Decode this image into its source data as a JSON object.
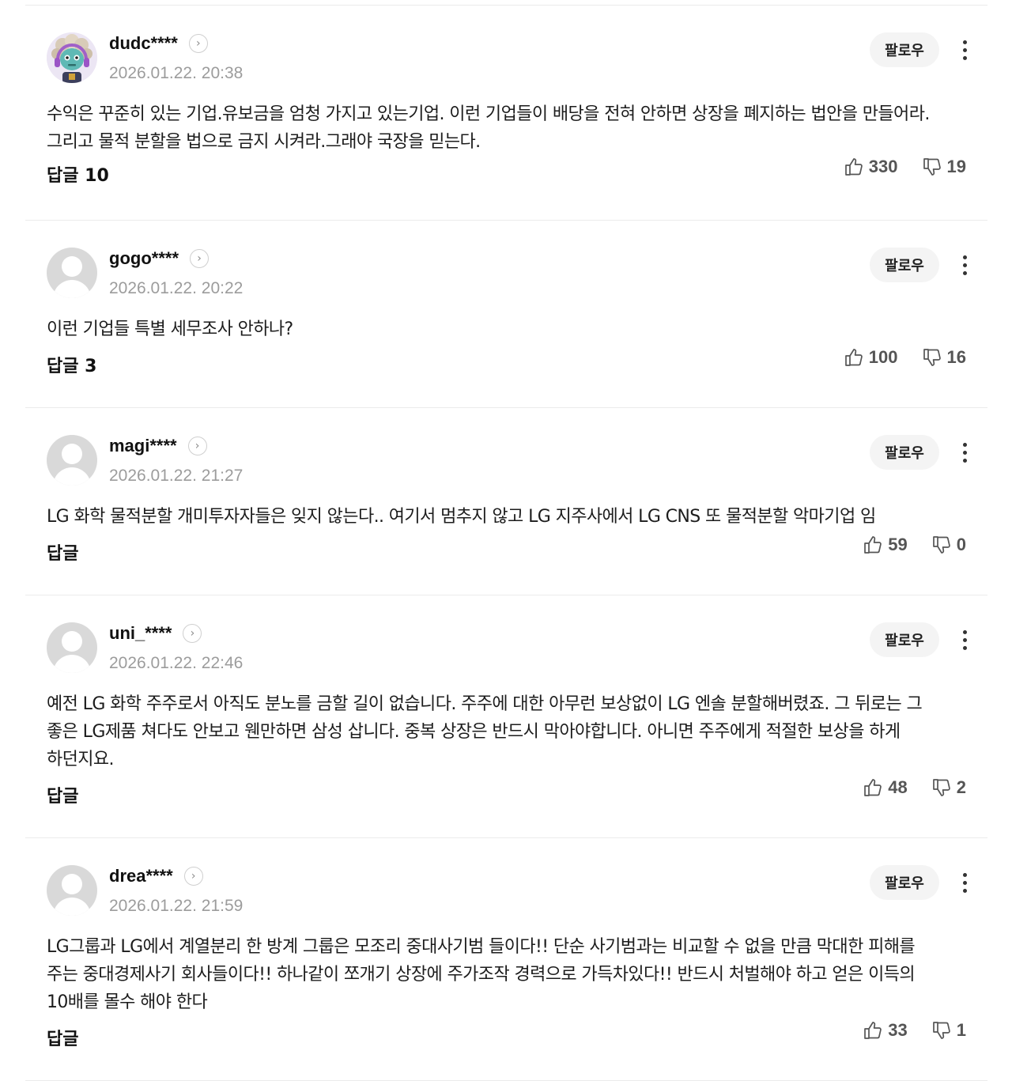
{
  "comments": [
    {
      "nickname": "dudc****",
      "date": "2026.01.22. 20:38",
      "follow_label": "팔로우",
      "text": "수익은 꾸준히 있는 기업.유보금을 엄청 가지고 있는기업. 이런 기업들이 배당을 전혀 안하면 상장을 폐지하는 법안을 만들어라. 그리고 물적 분할을 법으로 금지 시켜라.그래야 국장을 믿는다.",
      "reply_label": "답글 10",
      "likes": "330",
      "dislikes": "19",
      "avatar": "custom-character-avatar"
    },
    {
      "nickname": "gogo****",
      "date": "2026.01.22. 20:22",
      "follow_label": "팔로우",
      "text": "이런 기업들 특별 세무조사 안하나?",
      "reply_label": "답글 3",
      "likes": "100",
      "dislikes": "16",
      "avatar": "default-avatar"
    },
    {
      "nickname": "magi****",
      "date": "2026.01.22. 21:27",
      "follow_label": "팔로우",
      "text": "LG 화학 물적분할 개미투자자들은 잊지 않는다.. 여기서 멈추지 않고 LG 지주사에서 LG CNS 또 물적분할 악마기업 임",
      "reply_label": "답글",
      "likes": "59",
      "dislikes": "0",
      "avatar": "default-avatar"
    },
    {
      "nickname": "uni_****",
      "date": "2026.01.22. 22:46",
      "follow_label": "팔로우",
      "text": "예전 LG 화학 주주로서 아직도 분노를 금할 길이 없습니다. 주주에 대한 아무런 보상없이 LG 엔솔 분할해버렸죠. 그 뒤로는 그 좋은 LG제품 쳐다도 안보고 웬만하면 삼성 삽니다. 중복 상장은 반드시 막아야합니다. 아니면 주주에게 적절한 보상을 하게 하던지요.",
      "reply_label": "답글",
      "likes": "48",
      "dislikes": "2",
      "avatar": "default-avatar"
    },
    {
      "nickname": "drea****",
      "date": "2026.01.22. 21:59",
      "follow_label": "팔로우",
      "text": "LG그룹과 LG에서 계열분리 한 방계 그룹은 모조리 중대사기범 들이다!! 단순 사기범과는 비교할 수 없을 만큼 막대한 피해를 주는 중대경제사기 회사들이다!! 하나같이 쪼개기 상장에 주가조작 경력으로 가득차있다!! 반드시 처벌해야 하고 얻은 이득의 10배를 몰수 해야 한다",
      "reply_label": "답글",
      "likes": "33",
      "dislikes": "1",
      "avatar": "default-avatar"
    }
  ]
}
